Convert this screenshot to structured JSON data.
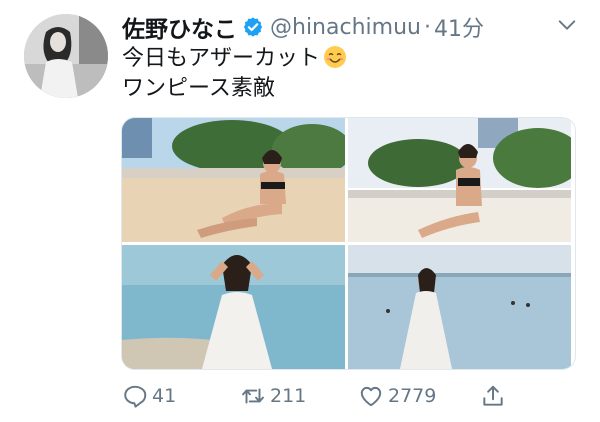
{
  "tweet": {
    "display_name": "佐野ひなこ",
    "handle": "@hinachimuu",
    "separator": "·",
    "time": "41分",
    "text_line1": "今日もアザーカット",
    "text_line2": "ワンピース素敵",
    "emoji_icon": "smiling-face-emoji"
  },
  "actions": {
    "reply_count": "41",
    "retweet_count": "211",
    "like_count": "2779"
  },
  "colors": {
    "accent": "#1da1f2",
    "secondary_text": "#657786"
  }
}
